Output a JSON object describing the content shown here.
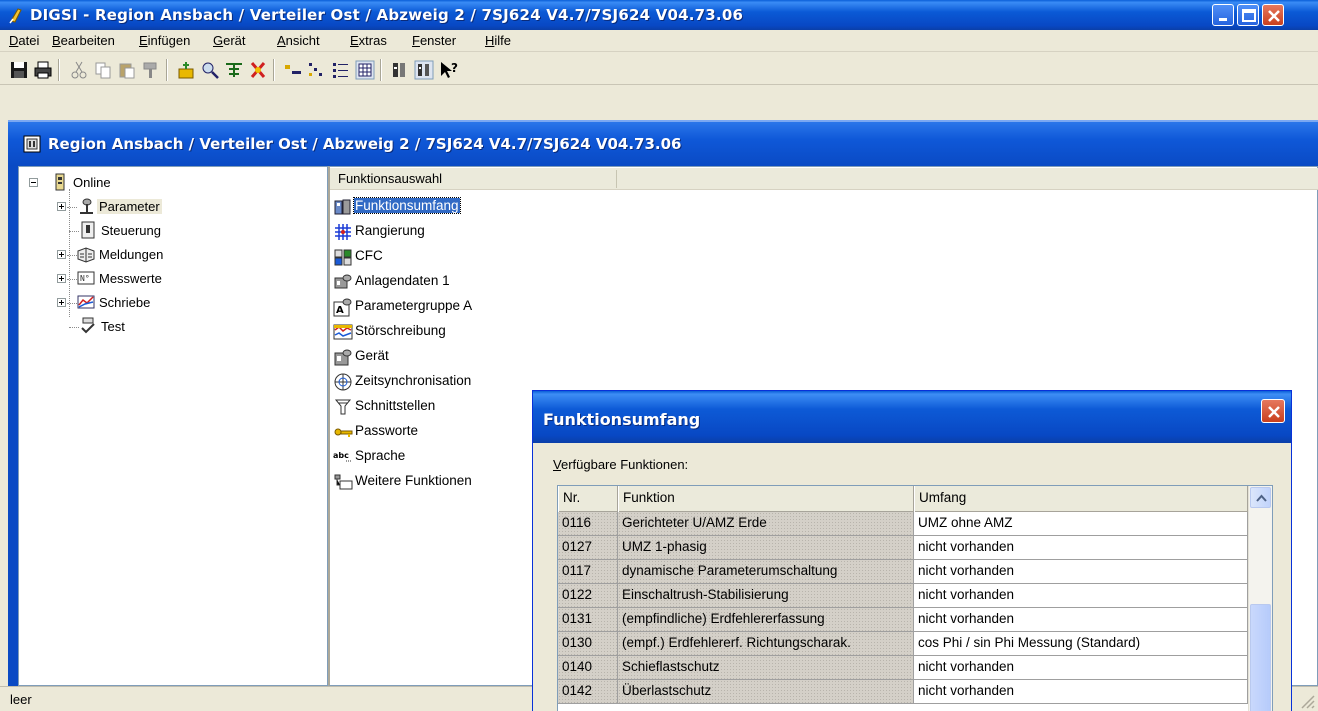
{
  "app": {
    "title": "DIGSI - Region Ansbach / Verteiler Ost / Abzweig 2 / 7SJ624 V4.7/7SJ624 V04.73.06"
  },
  "menu": {
    "items": [
      "Datei",
      "Bearbeiten",
      "Einfügen",
      "Gerät",
      "Ansicht",
      "Extras",
      "Fenster",
      "Hilfe"
    ]
  },
  "toolbar": {
    "buttons": [
      "save-icon",
      "print-icon",
      "cut-icon",
      "copy-icon",
      "paste-icon",
      "format-painter-icon",
      "device-icon",
      "find-icon",
      "insert-icon",
      "delete-icon",
      "large-icons-icon",
      "small-icons-icon",
      "list-view-icon",
      "details-view-icon",
      "reports-icon",
      "settings-icon",
      "context-help-icon"
    ]
  },
  "document": {
    "title": "Region Ansbach / Verteiler Ost / Abzweig 2 / 7SJ624 V4.7/7SJ624 V04.73.06"
  },
  "tree": {
    "root": "Online",
    "items": [
      "Parameter",
      "Steuerung",
      "Meldungen",
      "Messwerte",
      "Schriebe",
      "Test"
    ]
  },
  "list": {
    "header": "Funktionsauswahl",
    "items": [
      "Funktionsumfang",
      "Rangierung",
      "CFC",
      "Anlagendaten 1",
      "Parametergruppe A",
      "Störschreibung",
      "Gerät",
      "Zeitsynchronisation",
      "Schnittstellen",
      "Passworte",
      "Sprache",
      "Weitere Funktionen"
    ],
    "selected": "Funktionsumfang"
  },
  "status": {
    "text": "leer"
  },
  "dialog": {
    "title": "Funktionsumfang",
    "label": "Verfügbare Funktionen:",
    "columns": [
      "Nr.",
      "Funktion",
      "Umfang"
    ],
    "rows": [
      [
        "0116",
        "Gerichteter U/AMZ Erde",
        "UMZ ohne AMZ"
      ],
      [
        "0127",
        "UMZ 1-phasig",
        "nicht vorhanden"
      ],
      [
        "0117",
        "dynamische Parameterumschaltung",
        "nicht vorhanden"
      ],
      [
        "0122",
        "Einschaltrush-Stabilisierung",
        "nicht vorhanden"
      ],
      [
        "0131",
        "(empfindliche) Erdfehlererfassung",
        "nicht vorhanden"
      ],
      [
        "0130",
        "(empf.) Erdfehlererf. Richtungscharak.",
        "cos Phi / sin Phi Messung (Standard)"
      ],
      [
        "0140",
        "Schieflastschutz",
        "nicht vorhanden"
      ],
      [
        "0142",
        "Überlastschutz",
        "nicht vorhanden"
      ]
    ]
  },
  "colors": {
    "titlebar": "#0a4ac4",
    "selection": "#316ac5",
    "close_button": "#c9401e",
    "window_bg": "#ece9d8"
  }
}
